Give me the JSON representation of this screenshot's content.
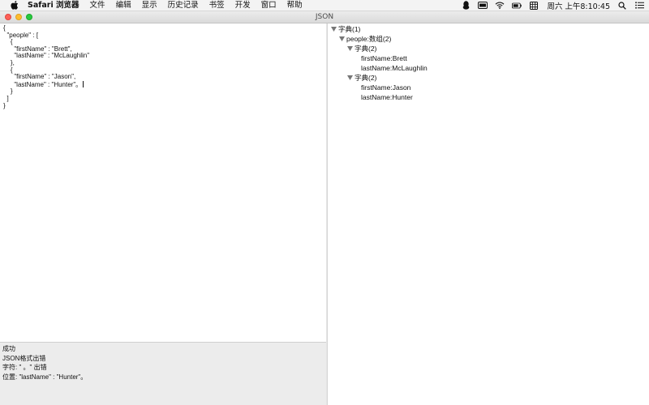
{
  "menubar": {
    "app_name": "Safari 浏览器",
    "items": [
      "文件",
      "编辑",
      "显示",
      "历史记录",
      "书签",
      "开发",
      "窗口",
      "帮助"
    ],
    "clock": "周六 上午8:10:45",
    "status_icons": [
      "qq-penguin-icon",
      "keyboard-input-icon",
      "wifi-icon",
      "battery-icon",
      "input-method-icon",
      "search-icon",
      "list-icon"
    ]
  },
  "window": {
    "title": "JSON"
  },
  "editor": {
    "lines": [
      "{",
      "  \"people\" : [",
      "    {",
      "      \"firstName\" : \"Brett\",",
      "      \"lastName\" : \"McLaughlin\"",
      "    },",
      "    {",
      "      \"firstName\" : \"Jason\",",
      "      \"lastName\" : \"Hunter\"。",
      "    }",
      "  ]",
      "}"
    ]
  },
  "status": {
    "line1": "成功",
    "line2": "JSON格式出错",
    "line3": "字符: \" 。\" 出错",
    "line4": "位置: \"lastName\" : \"Hunter\"。"
  },
  "tree": {
    "root": "字典(1)",
    "people": "people:数组(2)",
    "dict1": "字典(2)",
    "dict1_first": "firstName:Brett",
    "dict1_last": "lastName:McLaughlin",
    "dict2": "字典(2)",
    "dict2_first": "firstName:Jason",
    "dict2_last": "lastName:Hunter"
  }
}
